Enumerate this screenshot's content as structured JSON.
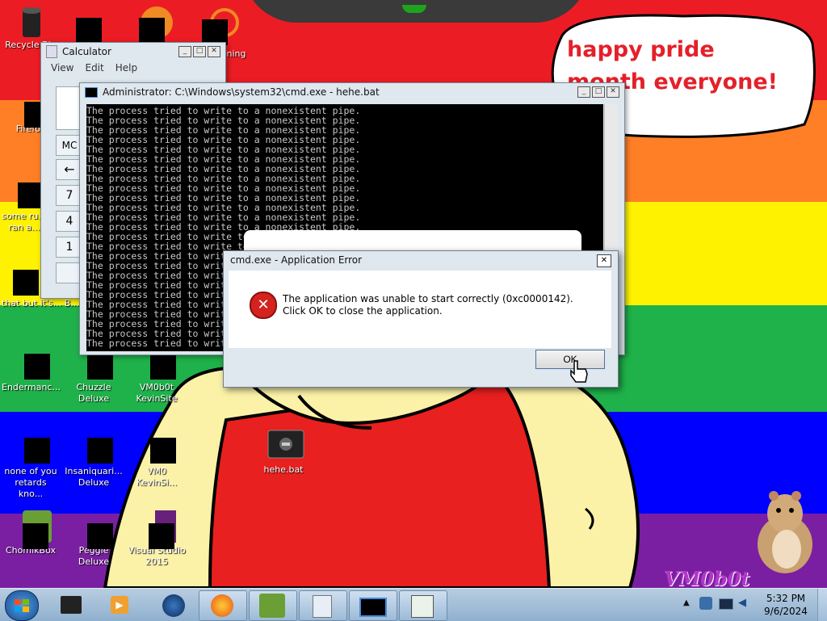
{
  "wallpaper": {
    "stripes": [
      "#ec1c24",
      "#ff7f27",
      "#fff200",
      "#1fb24a",
      "#0000ff",
      "#7a1fa2"
    ],
    "speech_bubble": "happy pride month everyone!",
    "signature": "VM0b0t"
  },
  "desktop_icons": [
    {
      "label": "Recycle Bin",
      "icon": "recycle-bin-icon"
    },
    {
      "label": "Firefox",
      "icon": "firefox-icon"
    },
    {
      "label": "some ru... ran a...",
      "icon": "folder-icon"
    },
    {
      "label": "that but it's... B...",
      "icon": "document-icon"
    },
    {
      "label": "Endermanc...",
      "icon": "app-icon"
    },
    {
      "label": "Chuzzle Deluxe",
      "icon": "chuzzle-icon"
    },
    {
      "label": "VM0b0t KevinSite",
      "icon": "app-icon"
    },
    {
      "label": "none of you retards kno...",
      "icon": "app-icon"
    },
    {
      "label": "Insaniquari... Deluxe",
      "icon": "game-icon"
    },
    {
      "label": "VM0 KevinSi...",
      "icon": "app-icon"
    },
    {
      "label": "hehe.bat",
      "icon": "batch-file-icon"
    },
    {
      "label": "ChomikBox",
      "icon": "chomikbox-icon"
    },
    {
      "label": "Peggle Deluxe",
      "icon": "peggle-icon"
    },
    {
      "label": "Visual Studio 2015",
      "icon": "visual-studio-icon"
    },
    {
      "label": "...ning",
      "icon": "app-icon"
    }
  ],
  "calculator": {
    "title": "Calculator",
    "menu": [
      "View",
      "Edit",
      "Help"
    ],
    "buttons": [
      "MC",
      "←",
      "7",
      "4",
      "1"
    ]
  },
  "cmd": {
    "title": "Administrator: C:\\Windows\\system32\\cmd.exe - hehe.bat",
    "line": "The process tried to write to a nonexistent pipe.",
    "line_count": 25
  },
  "dialog": {
    "title": "cmd.exe - Application Error",
    "message": "The application was unable to start correctly (0xc0000142). Click OK to close the application.",
    "ok_label": "OK",
    "close_label": "✕"
  },
  "taskbar": {
    "time": "5:32 PM",
    "date": "9/6/2024",
    "apps": [
      "windows-media-icon",
      "media-player-icon",
      "globe-icon",
      "firefox-icon",
      "chomikbox-icon",
      "calculator-icon",
      "cmd-icon",
      "notepad-icon"
    ],
    "tray": [
      "up-arrow-icon",
      "network-icon",
      "monitor-icon",
      "speaker-icon"
    ]
  }
}
